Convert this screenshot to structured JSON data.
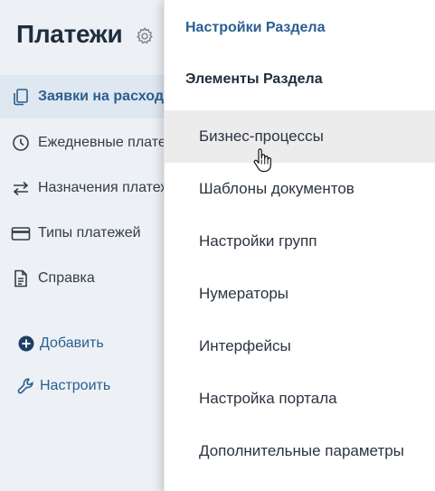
{
  "header": {
    "title": "Платежи",
    "settings_icon": "gear-icon"
  },
  "sidebar": {
    "items": [
      {
        "label": "Заявки на расходы",
        "icon": "documents-icon",
        "active": true
      },
      {
        "label": "Ежедневные платежи",
        "icon": "clock-icon",
        "active": false
      },
      {
        "label": "Назначения платежей",
        "icon": "swap-arrows-icon",
        "active": false
      },
      {
        "label": "Типы платежей",
        "icon": "credit-card-icon",
        "active": false
      },
      {
        "label": "Справка",
        "icon": "document-icon",
        "active": false
      }
    ],
    "actions": [
      {
        "label": "Добавить",
        "icon": "plus-circle-icon"
      },
      {
        "label": "Настроить",
        "icon": "wrench-icon"
      }
    ]
  },
  "menu": {
    "header_link": "Настройки Раздела",
    "section_title": "Элементы Раздела",
    "items": [
      {
        "label": "Бизнес-процессы",
        "hovered": true
      },
      {
        "label": "Шаблоны документов",
        "hovered": false
      },
      {
        "label": "Настройки групп",
        "hovered": false
      },
      {
        "label": "Нумераторы",
        "hovered": false
      },
      {
        "label": "Интерфейсы",
        "hovered": false
      },
      {
        "label": "Настройка портала",
        "hovered": false
      },
      {
        "label": "Дополнительные параметры",
        "hovered": false
      }
    ]
  },
  "colors": {
    "accent": "#2a5f92",
    "sidebar_bg": "#edf1f5",
    "active_bg": "#dfe7f0",
    "hover_bg": "#ececec",
    "text": "#2b3440"
  },
  "cursor": "hand-pointer"
}
